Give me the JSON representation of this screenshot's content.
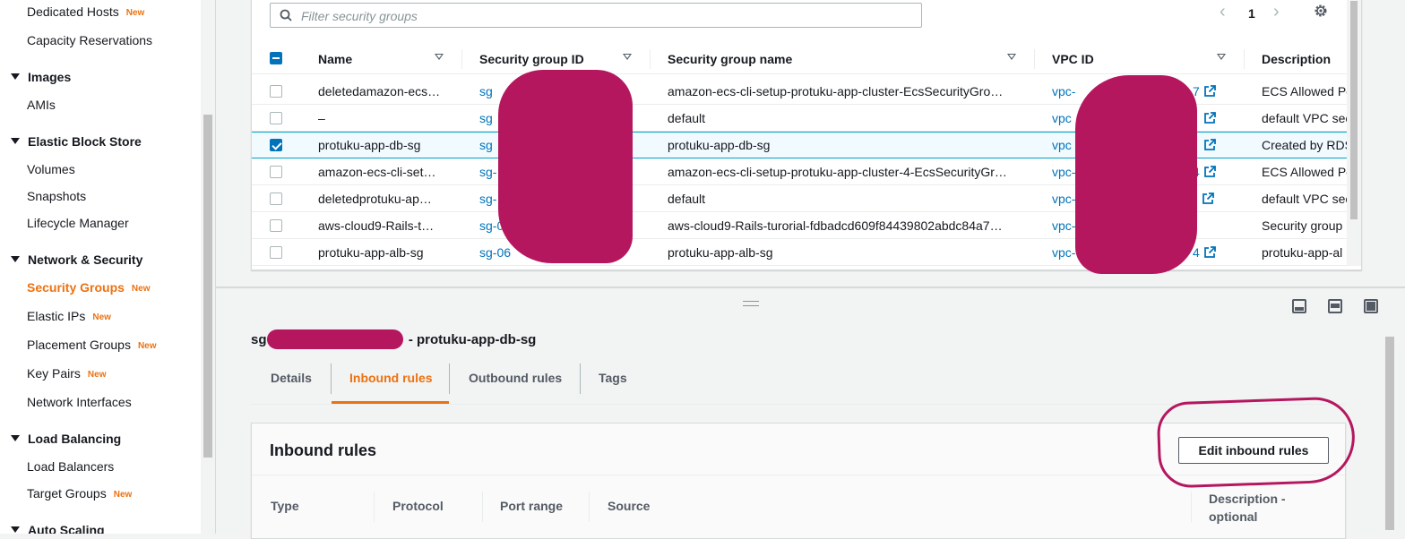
{
  "sidebar": {
    "items": [
      {
        "label": "Dedicated Hosts",
        "badge": "New"
      },
      {
        "label": "Capacity Reservations",
        "badge": ""
      },
      {
        "label": "Images",
        "section": true
      },
      {
        "label": "AMIs",
        "badge": ""
      },
      {
        "label": "Elastic Block Store",
        "section": true
      },
      {
        "label": "Volumes",
        "badge": ""
      },
      {
        "label": "Snapshots",
        "badge": ""
      },
      {
        "label": "Lifecycle Manager",
        "badge": ""
      },
      {
        "label": "Network & Security",
        "section": true
      },
      {
        "label": "Security Groups",
        "badge": "New",
        "active": true
      },
      {
        "label": "Elastic IPs",
        "badge": "New"
      },
      {
        "label": "Placement Groups",
        "badge": "New"
      },
      {
        "label": "Key Pairs",
        "badge": "New"
      },
      {
        "label": "Network Interfaces",
        "badge": ""
      },
      {
        "label": "Load Balancing",
        "section": true
      },
      {
        "label": "Load Balancers",
        "badge": ""
      },
      {
        "label": "Target Groups",
        "badge": "New"
      },
      {
        "label": "Auto Scaling",
        "section": true
      }
    ]
  },
  "table": {
    "filter_placeholder": "Filter security groups",
    "page": "1",
    "columns": [
      "Name",
      "Security group ID",
      "Security group name",
      "VPC ID",
      "Description"
    ],
    "rows": [
      {
        "name": "deletedamazon-ecs…",
        "sg_id": "sg",
        "sg_name": "amazon-ecs-cli-setup-protuku-app-cluster-EcsSecurityGro…",
        "vpc": "vpc-",
        "vpc_tail": "7",
        "desc": "ECS Allowed Po",
        "checked": false
      },
      {
        "name": "–",
        "sg_id": "sg",
        "sg_name": "default",
        "vpc": "vpc",
        "vpc_tail": "",
        "desc": "default VPC sec",
        "checked": false
      },
      {
        "name": "protuku-app-db-sg",
        "sg_id": "sg",
        "sg_name": "protuku-app-db-sg",
        "vpc": "vpc",
        "vpc_tail": "",
        "desc": "Created by RDS",
        "checked": true
      },
      {
        "name": "amazon-ecs-cli-set…",
        "sg_id": "sg-",
        "sg_name": "amazon-ecs-cli-setup-protuku-app-cluster-4-EcsSecurityGr…",
        "vpc": "vpc-",
        "vpc_tail": "4",
        "desc": "ECS Allowed Po",
        "checked": false
      },
      {
        "name": "deletedprotuku-ap…",
        "sg_id": "sg-",
        "sg_name": "default",
        "vpc": "vpc-0",
        "vpc_tail": "",
        "desc": "default VPC sec",
        "checked": false
      },
      {
        "name": "aws-cloud9-Rails-t…",
        "sg_id": "sg-0",
        "sg_name": "aws-cloud9-Rails-turorial-fdbadcd609f84439802abdc84a7…",
        "vpc": "vpc-",
        "vpc_tail": "",
        "desc": "Security group",
        "checked": false
      },
      {
        "name": "protuku-app-alb-sg",
        "sg_id": "sg-06",
        "sg_name": "protuku-app-alb-sg",
        "vpc": "vpc-",
        "vpc_tail": "4",
        "desc": "protuku-app-al",
        "checked": false
      }
    ]
  },
  "detail": {
    "title_prefix": "sg",
    "title_suffix": "- protuku-app-db-sg",
    "tabs": [
      "Details",
      "Inbound rules",
      "Outbound rules",
      "Tags"
    ],
    "active_tab": "Inbound rules",
    "rules_title": "Inbound rules",
    "edit_button": "Edit inbound rules",
    "rule_columns": [
      "Type",
      "Protocol",
      "Port range",
      "Source"
    ],
    "rule_desc_column": "Description - optional"
  },
  "colors": {
    "accent": "#ec7211",
    "link": "#0073bb",
    "redaction": "#b5175f"
  }
}
